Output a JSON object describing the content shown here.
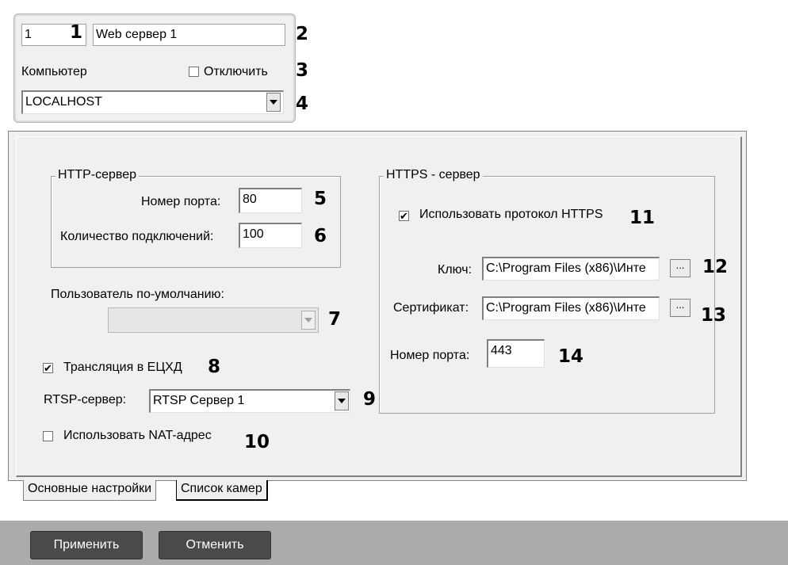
{
  "top": {
    "id_value": "1",
    "name_value": "Web сервер 1",
    "computer_label": "Компьютер",
    "disable_label": "Отключить",
    "disable_checked": false,
    "computer_value": "LOCALHOST"
  },
  "http": {
    "group_title": "HTTP-сервер",
    "port_label": "Номер порта:",
    "port_value": "80",
    "connections_label": "Количество подключений:",
    "connections_value": "100"
  },
  "default_user": {
    "label": "Пользователь по-умолчанию:",
    "value": ""
  },
  "euchd": {
    "label": "Трансляция в ЕЦХД",
    "checked": true
  },
  "rtsp": {
    "label": "RTSP-сервер:",
    "value": "RTSP Сервер 1"
  },
  "nat": {
    "label": "Использовать NAT-адрес",
    "checked": false
  },
  "https": {
    "group_title": "HTTPS - сервер",
    "use_label": "Использовать протокол HTTPS",
    "use_checked": true,
    "key_label": "Ключ:",
    "key_value": "C:\\Program Files (x86)\\Инте",
    "cert_label": "Сертификат:",
    "cert_value": "C:\\Program Files (x86)\\Инте",
    "browse_label": "...",
    "port_label": "Номер порта:",
    "port_value": "443"
  },
  "callouts": [
    "1",
    "2",
    "3",
    "4",
    "5",
    "6",
    "7",
    "8",
    "9",
    "10",
    "11",
    "12",
    "13",
    "14"
  ],
  "tabs": [
    "Основные настройки",
    "Список камер"
  ],
  "buttons": {
    "apply": "Применить",
    "cancel": "Отменить"
  },
  "check_mark": "✔"
}
